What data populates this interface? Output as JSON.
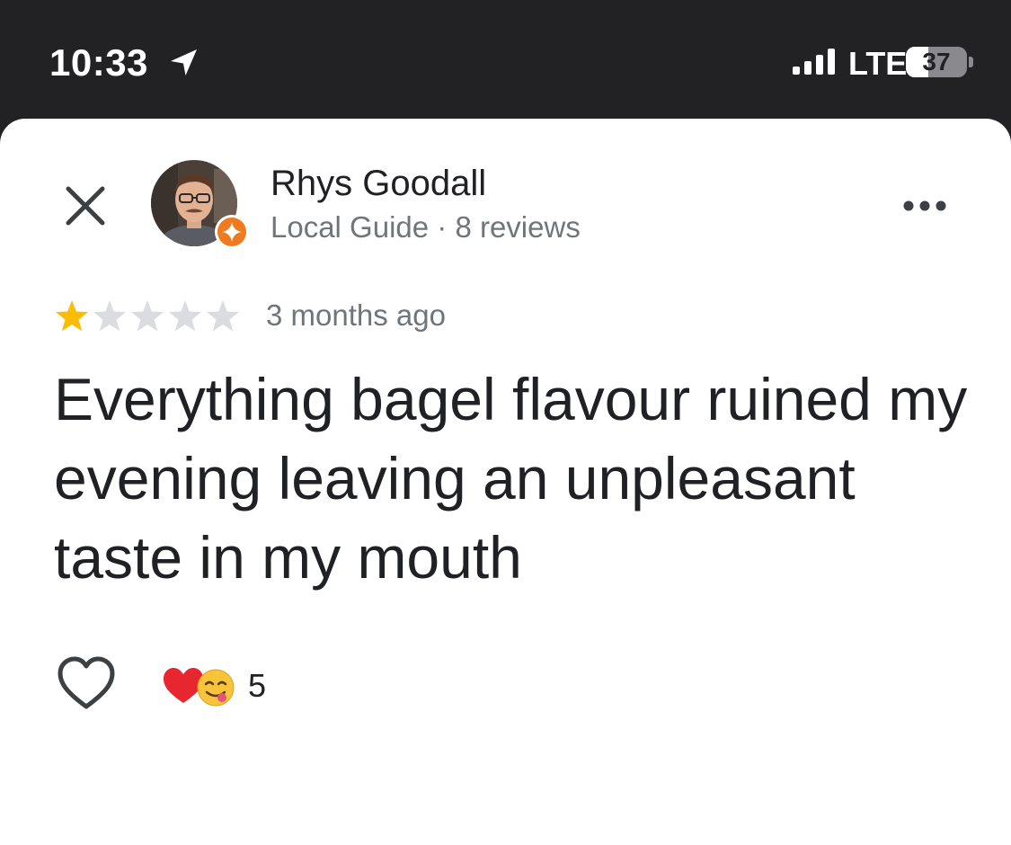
{
  "status_bar": {
    "time": "10:33",
    "network": "LTE",
    "battery_level": "37",
    "battery_fraction": 0.37,
    "icons": [
      "location-arrow-icon",
      "cellular-signal-icon",
      "battery-icon"
    ]
  },
  "review": {
    "reviewer_name": "Rhys Goodall",
    "reviewer_meta": "Local Guide · 8 reviews",
    "rating": 1,
    "rating_max": 5,
    "date": "3 months ago",
    "text": "Everything bagel flavour ruined my evening leaving an unpleasant taste in my mouth",
    "reactions": {
      "emojis": [
        "red-heart-emoji",
        "face-savoring-food-emoji"
      ],
      "count": "5"
    }
  },
  "icons": {
    "close": "close-icon",
    "more": "more-options-icon",
    "like": "heart-outline-icon",
    "badge": "local-guide-badge-icon"
  },
  "colors": {
    "status_bar_bg": "#222224",
    "star_filled": "#fbbc04",
    "star_empty": "#dadce0",
    "badge": "#f07a20",
    "text_primary": "#202124",
    "text_secondary": "#70757a"
  }
}
